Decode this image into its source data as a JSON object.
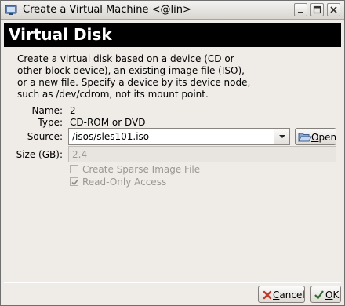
{
  "window": {
    "title": "Create a Virtual Machine <@lin>"
  },
  "header": {
    "title": "Virtual Disk"
  },
  "description": "Create a virtual disk based on a device (CD or other block device), an existing image file (ISO), or a new file.  Specify a device by its device node, such as /dev/cdrom, not its mount point.",
  "fields": {
    "name_label": "Name:",
    "name_value": "2",
    "type_label": "Type:",
    "type_value": "CD-ROM or DVD",
    "source_label": "Source:",
    "source_value": "/isos/sles101.iso",
    "size_label": "Size (GB):",
    "size_value": "2.4"
  },
  "open_button": {
    "label_first": "O",
    "label_rest": "pen"
  },
  "options": {
    "sparse_label": "Create Sparse Image File",
    "sparse_checked": false,
    "readonly_label": "Read-Only Access",
    "readonly_checked": true
  },
  "footer": {
    "cancel_first": "C",
    "cancel_rest": "ancel",
    "ok_first": "O",
    "ok_rest": "K"
  },
  "icons": {
    "app": "app-icon",
    "minimize": "minimize-icon",
    "maximize": "maximize-icon",
    "close": "close-icon",
    "dropdown": "chevron-down-icon",
    "open": "folder-open-icon",
    "cancel": "cancel-x-icon",
    "ok": "ok-check-icon"
  }
}
